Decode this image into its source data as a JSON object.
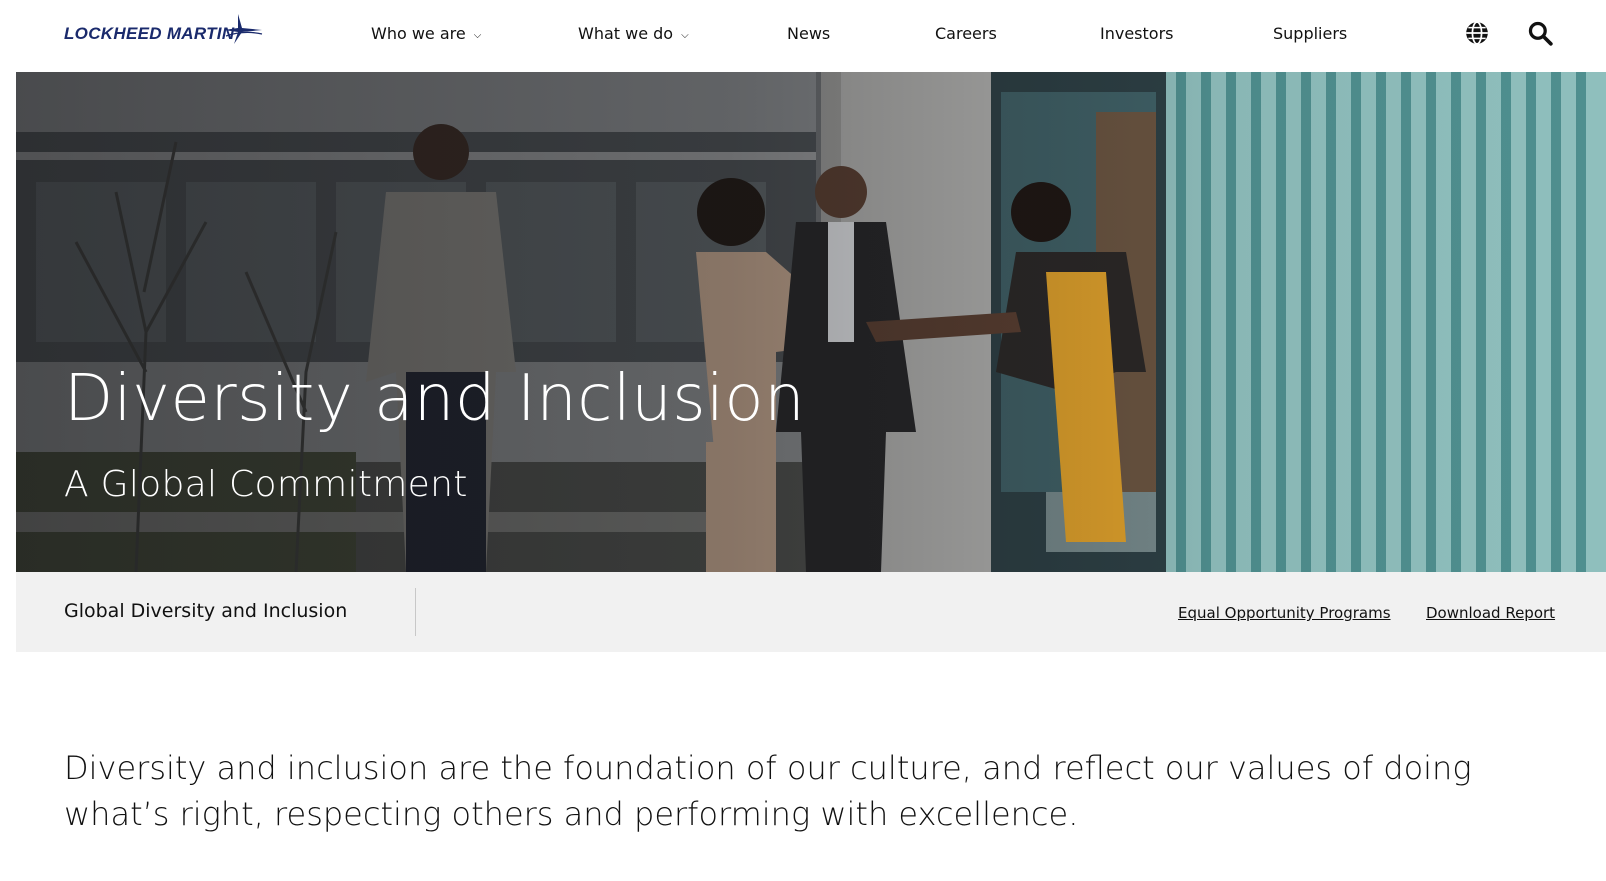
{
  "brand": {
    "name": "LOCKHEED MARTIN",
    "color": "#1a2a6c"
  },
  "nav": {
    "items": [
      {
        "label": "Who we are",
        "has_dropdown": true
      },
      {
        "label": "What we do",
        "has_dropdown": true
      },
      {
        "label": "News",
        "has_dropdown": false
      },
      {
        "label": "Careers",
        "has_dropdown": false
      },
      {
        "label": "Investors",
        "has_dropdown": false
      },
      {
        "label": "Suppliers",
        "has_dropdown": false
      }
    ],
    "icons": [
      "globe-icon",
      "search-icon"
    ]
  },
  "hero": {
    "title": "Diversity and Inclusion",
    "subtitle": "A Global Commitment"
  },
  "subnav": {
    "title": "Global Diversity and Inclusion",
    "links": [
      "Equal Opportunity Programs",
      "Download Report"
    ]
  },
  "intro": {
    "text": "Diversity and inclusion are the foundation of our culture, and reflect our values of doing what’s right, respecting others and performing with excellence."
  }
}
